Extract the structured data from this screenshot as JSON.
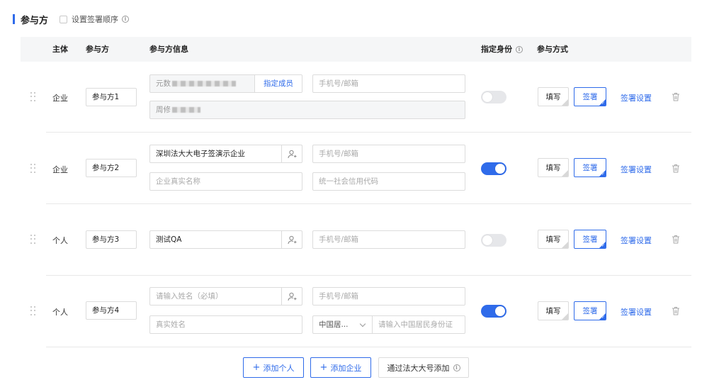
{
  "section": {
    "title": "参与方",
    "set_order_label": "设置签署顺序",
    "info_glyph": "i"
  },
  "table_headers": {
    "subject": "主体",
    "participant": "参与方",
    "participant_info": "参与方信息",
    "assign_identity": "指定身份",
    "participation_method": "参与方式"
  },
  "rows": [
    {
      "subject": "企业",
      "participant_name": "参与方1",
      "company_value": "元数",
      "assign_member_label": "指定成员",
      "contact_placeholder": "手机号/邮箱",
      "member_value": "周修",
      "assign_identity_on": false,
      "fill_label": "填写",
      "sign_label": "签署",
      "sign_settings_label": "签署设置"
    },
    {
      "subject": "企业",
      "participant_name": "参与方2",
      "company_value": "深圳法大大电子签演示企业",
      "contact_placeholder": "手机号/邮箱",
      "real_name_placeholder": "企业真实名称",
      "credit_code_placeholder": "统一社会信用代码",
      "assign_identity_on": true,
      "fill_label": "填写",
      "sign_label": "签署",
      "sign_settings_label": "签署设置"
    },
    {
      "subject": "个人",
      "participant_name": "参与方3",
      "person_value": "测试QA",
      "contact_placeholder": "手机号/邮箱",
      "assign_identity_on": false,
      "fill_label": "填写",
      "sign_label": "签署",
      "sign_settings_label": "签署设置"
    },
    {
      "subject": "个人",
      "participant_name": "参与方4",
      "name_placeholder": "请输入姓名（必填）",
      "contact_placeholder": "手机号/邮箱",
      "real_name_placeholder": "真实姓名",
      "id_type_value": "中国居...",
      "id_number_placeholder": "请输入中国居民身份证",
      "assign_identity_on": true,
      "fill_label": "填写",
      "sign_label": "签署",
      "sign_settings_label": "签署设置"
    }
  ],
  "footer": {
    "add_person_label": "添加个人",
    "add_company_label": "添加企业",
    "add_via_account_label": "通过法大大号添加"
  },
  "colors": {
    "accent": "#2f6bea",
    "toggle_off": "#e6e7ea",
    "header_bg": "#f5f6f7"
  }
}
